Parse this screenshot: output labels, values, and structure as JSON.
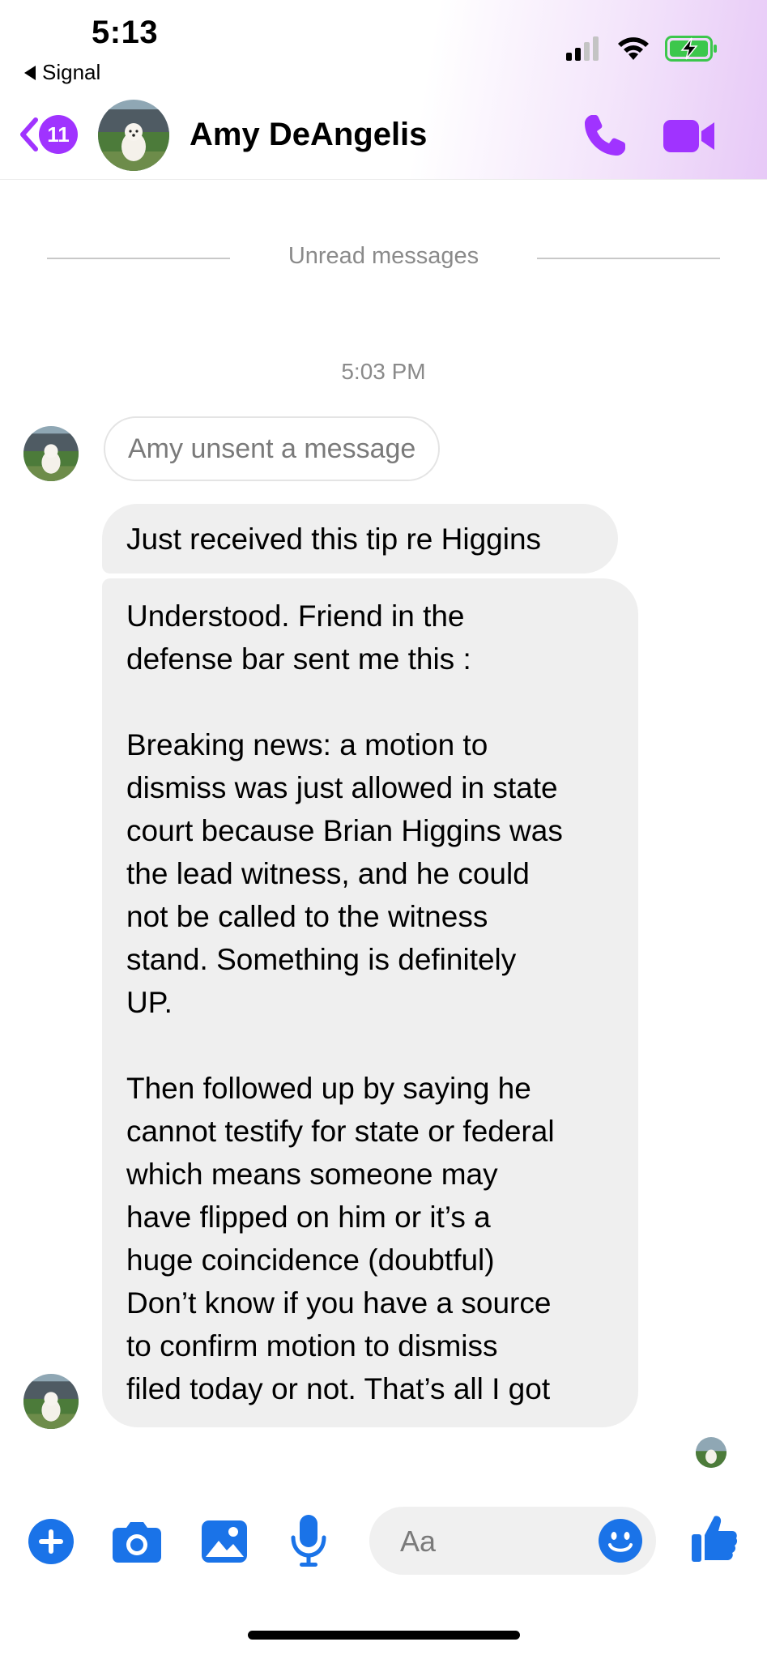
{
  "status_bar": {
    "time": "5:13",
    "back_app_label": "Signal",
    "battery_color": "#3cc74c"
  },
  "header": {
    "back_badge_count": "11",
    "contact_name": "Amy DeAngelis",
    "accent_color": "#a033ff",
    "icons": [
      "chevron-left-icon",
      "phone-icon",
      "video-camera-icon"
    ]
  },
  "conversation": {
    "unread_divider": "Unread messages",
    "timestamp": "5:03 PM",
    "unsent_notice": "Amy unsent a message",
    "messages": [
      {
        "sender": "Amy DeAngelis",
        "text": "Just received this tip re Higgins"
      },
      {
        "sender": "Amy DeAngelis",
        "text": "Understood. Friend in the\ndefense bar sent me this :\n\nBreaking news: a motion to\ndismiss was just allowed in state\ncourt because Brian Higgins was\nthe lead witness, and he could\nnot be called to the witness\nstand. Something is definitely\nUP.\n\nThen followed up by saying he\ncannot testify for state or federal\nwhich means someone may\nhave flipped on him or it’s a\nhuge coincidence (doubtful)\nDon’t know if you have a source\nto confirm motion to dismiss\nfiled today or not. That’s all I got"
      }
    ]
  },
  "composer": {
    "placeholder": "Aa",
    "accent_color": "#1a73e8",
    "icons": [
      "plus-icon",
      "camera-icon",
      "gallery-icon",
      "microphone-icon",
      "emoji-icon",
      "thumbs-up-icon"
    ]
  }
}
